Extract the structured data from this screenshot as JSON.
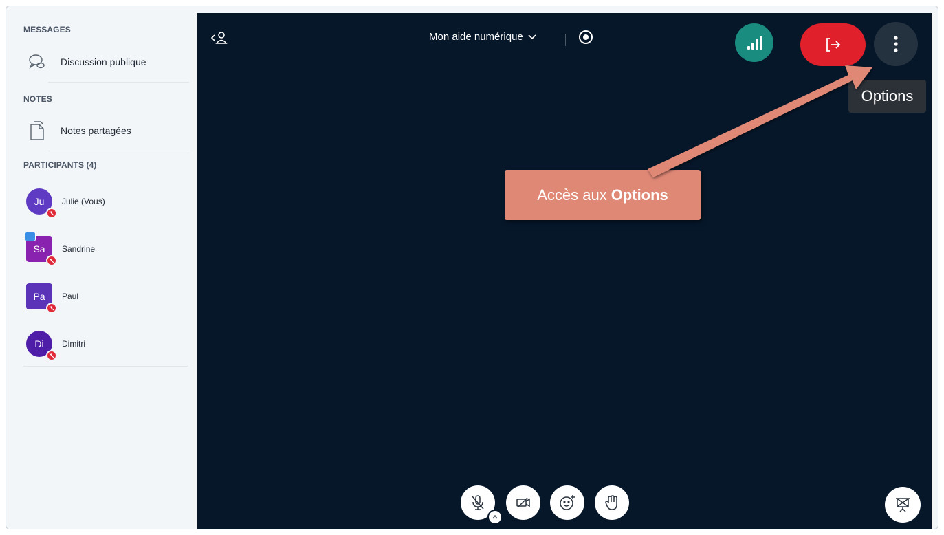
{
  "sidebar": {
    "messages_title": "MESSAGES",
    "public_chat": "Discussion publique",
    "notes_title": "NOTES",
    "shared_notes": "Notes partagées",
    "participants_title": "PARTICIPANTS (4)",
    "participants": [
      {
        "initials": "Ju",
        "name": "Julie (Vous)",
        "color": "#5f3ac2"
      },
      {
        "initials": "Sa",
        "name": "Sandrine",
        "color": "#8a22b0"
      },
      {
        "initials": "Pa",
        "name": "Paul",
        "color": "#5a33b8"
      },
      {
        "initials": "Di",
        "name": "Dimitri",
        "color": "#4f1ea8"
      }
    ]
  },
  "header": {
    "meeting_title": "Mon aide numérique"
  },
  "colors": {
    "main_bg": "#06172a",
    "leave": "#e0202b",
    "connection": "#1a8b7f",
    "callout": "#e08876"
  },
  "tooltip": {
    "text": "Options"
  },
  "callout": {
    "prefix": "Accès aux",
    "bold": "Options"
  },
  "icons": {
    "collapse": "collapse-sidebar-icon",
    "chat": "chat-bubble-icon",
    "notes": "document-icon",
    "record": "record-icon",
    "connection": "signal-bars-icon",
    "leave": "exit-icon",
    "options": "kebab-menu-icon",
    "mic": "mic-muted-icon",
    "camera": "camera-off-icon",
    "emoji": "emoji-add-icon",
    "hand": "raise-hand-icon",
    "presentation": "presentation-icon"
  }
}
